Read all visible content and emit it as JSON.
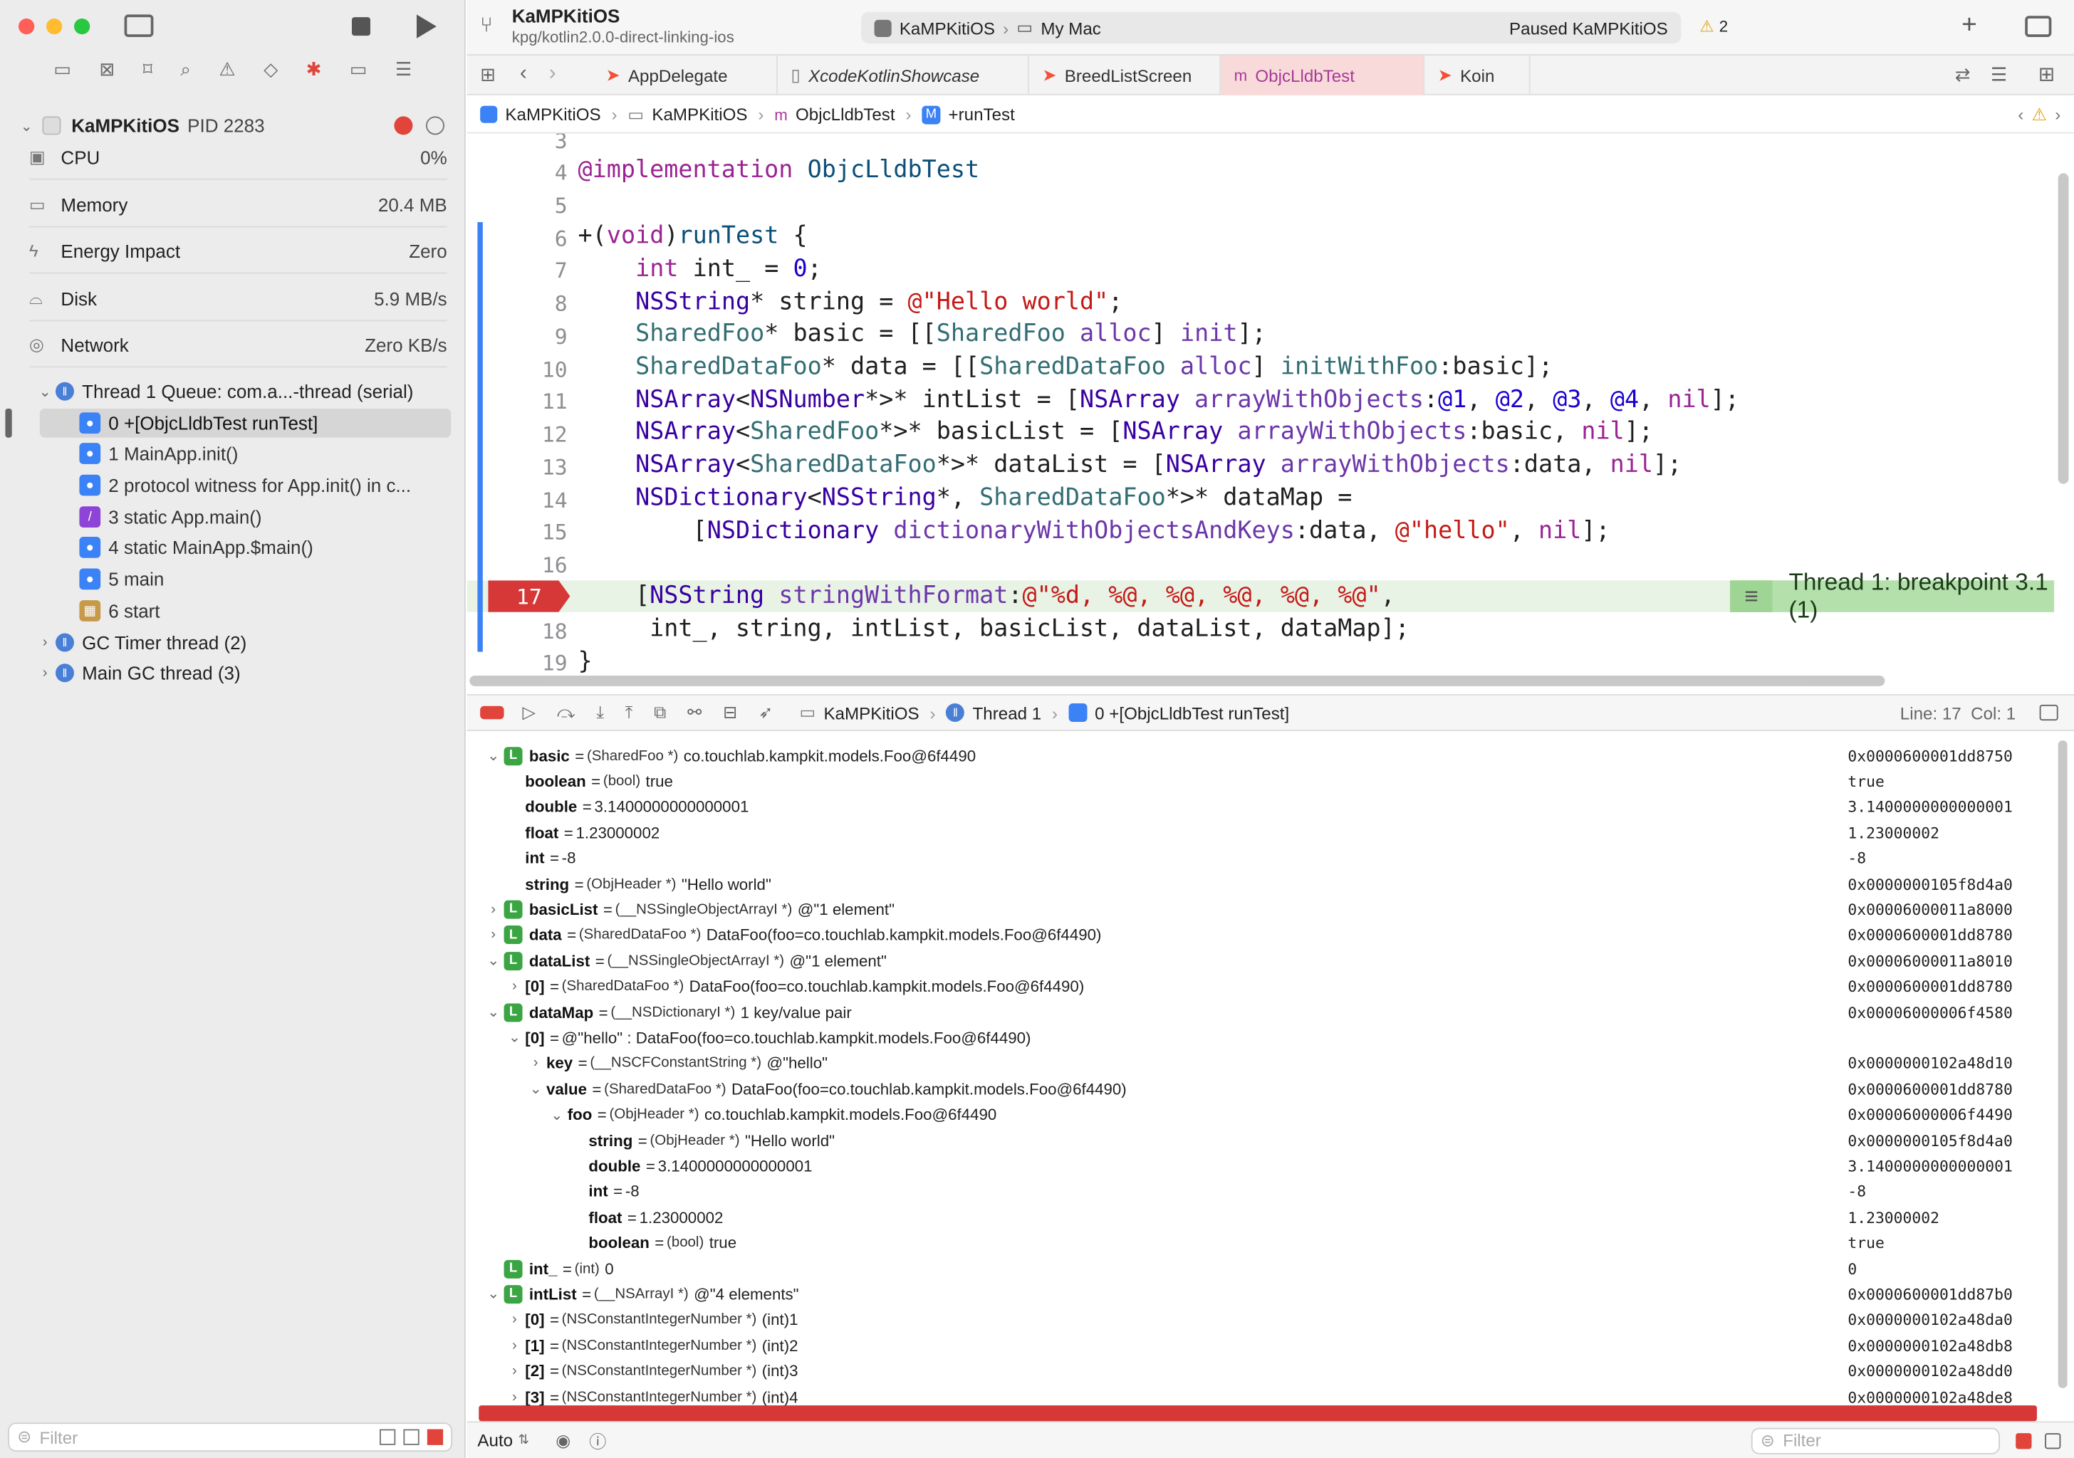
{
  "window": {
    "scheme": "KaMPKitiOS",
    "branch": "kpg/kotlin2.0.0-direct-linking-ios",
    "run_target": "KaMPKitiOS",
    "run_destination": "My Mac",
    "status": "Paused KaMPKitiOS",
    "warnings": "2"
  },
  "tabs": [
    {
      "label": "AppDelegate",
      "icon": "swift-icon"
    },
    {
      "label": "XcodeKotlinShowcase",
      "icon": "file-icon"
    },
    {
      "label": "BreedListScreen",
      "icon": "swift-icon"
    },
    {
      "label": "ObjcLldbTest",
      "icon": "m",
      "active": true
    },
    {
      "label": "Koin",
      "icon": "swift-icon"
    }
  ],
  "breadcrumb": [
    "KaMPKitiOS",
    "KaMPKitiOS",
    "ObjcLldbTest",
    "+runTest"
  ],
  "process": {
    "name": "KaMPKitiOS",
    "pid": "PID 2283"
  },
  "gauges": [
    {
      "label": "CPU",
      "value": "0%"
    },
    {
      "label": "Memory",
      "value": "20.4 MB"
    },
    {
      "label": "Energy Impact",
      "value": "Zero"
    },
    {
      "label": "Disk",
      "value": "5.9 MB/s"
    },
    {
      "label": "Network",
      "value": "Zero KB/s"
    }
  ],
  "thread1": "Thread 1 Queue: com.a...-thread (serial)",
  "frames": [
    "0 +[ObjcLldbTest runTest]",
    "1 MainApp.init()",
    "2 protocol witness for App.init() in c...",
    "3 static App.main()",
    "4 static MainApp.$main()",
    "5 main",
    "6 start"
  ],
  "other_threads": [
    "GC Timer thread (2)",
    "Main GC thread (3)"
  ],
  "filter_placeholder": "Filter",
  "line_numbers": [
    "3",
    "4",
    "5",
    "6",
    "7",
    "8",
    "9",
    "10",
    "11",
    "12",
    "13",
    "14",
    "15",
    "16",
    "17",
    "18",
    "19"
  ],
  "breakpoint_label": "Thread 1: breakpoint 3.1 (1)",
  "debug_bar": {
    "target": "KaMPKitiOS",
    "thread": "Thread 1",
    "frame": "0 +[ObjcLldbTest runTest]",
    "position": "Line: 17  Col: 1"
  },
  "variables": [
    {
      "d": 0,
      "exp": "v",
      "L": true,
      "name": "basic",
      "type": "(SharedFoo *)",
      "val": "co.touchlab.kampkit.models.Foo@6f4490",
      "addr": "0x0000600001dd8750"
    },
    {
      "d": 1,
      "name": "boolean",
      "type": "(bool)",
      "val": "true",
      "addr": "true"
    },
    {
      "d": 1,
      "name": "double",
      "type": "",
      "val": "3.1400000000000001",
      "addr": "3.1400000000000001"
    },
    {
      "d": 1,
      "name": "float",
      "type": "",
      "val": "1.23000002",
      "addr": "1.23000002"
    },
    {
      "d": 1,
      "name": "int",
      "type": "",
      "val": "-8",
      "addr": "-8"
    },
    {
      "d": 1,
      "name": "string",
      "type": "(ObjHeader *)",
      "val": "\"Hello world\"",
      "addr": "0x0000000105f8d4a0"
    },
    {
      "d": 0,
      "exp": ">",
      "L": true,
      "name": "basicList",
      "type": "(__NSSingleObjectArrayI *)",
      "val": "@\"1 element\"",
      "addr": "0x00006000011a8000"
    },
    {
      "d": 0,
      "exp": ">",
      "L": true,
      "name": "data",
      "type": "(SharedDataFoo *)",
      "val": "DataFoo(foo=co.touchlab.kampkit.models.Foo@6f4490)",
      "addr": "0x0000600001dd8780"
    },
    {
      "d": 0,
      "exp": "v",
      "L": true,
      "name": "dataList",
      "type": "(__NSSingleObjectArrayI *)",
      "val": "@\"1 element\"",
      "addr": "0x00006000011a8010"
    },
    {
      "d": 1,
      "exp": ">",
      "name": "[0]",
      "type": "(SharedDataFoo *)",
      "val": "DataFoo(foo=co.touchlab.kampkit.models.Foo@6f4490)",
      "addr": "0x0000600001dd8780"
    },
    {
      "d": 0,
      "exp": "v",
      "L": true,
      "name": "dataMap",
      "type": "(__NSDictionaryI *)",
      "val": "1 key/value pair",
      "addr": "0x00006000006f4580"
    },
    {
      "d": 1,
      "exp": "v",
      "name": "[0]",
      "type": "",
      "val": "@\"hello\" : DataFoo(foo=co.touchlab.kampkit.models.Foo@6f4490)",
      "addr": ""
    },
    {
      "d": 2,
      "exp": ">",
      "name": "key",
      "type": "(__NSCFConstantString *)",
      "val": "@\"hello\"",
      "addr": "0x0000000102a48d10"
    },
    {
      "d": 2,
      "exp": "v",
      "name": "value",
      "type": "(SharedDataFoo *)",
      "val": "DataFoo(foo=co.touchlab.kampkit.models.Foo@6f4490)",
      "addr": "0x0000600001dd8780"
    },
    {
      "d": 3,
      "exp": "v",
      "name": "foo",
      "type": "(ObjHeader *)",
      "val": "co.touchlab.kampkit.models.Foo@6f4490",
      "addr": "0x00006000006f4490"
    },
    {
      "d": 4,
      "name": "string",
      "type": "(ObjHeader *)",
      "val": "\"Hello world\"",
      "addr": "0x0000000105f8d4a0"
    },
    {
      "d": 4,
      "name": "double",
      "type": "",
      "val": "3.1400000000000001",
      "addr": "3.1400000000000001"
    },
    {
      "d": 4,
      "name": "int",
      "type": "",
      "val": "-8",
      "addr": "-8"
    },
    {
      "d": 4,
      "name": "float",
      "type": "",
      "val": "1.23000002",
      "addr": "1.23000002"
    },
    {
      "d": 4,
      "name": "boolean",
      "type": "(bool)",
      "val": "true",
      "addr": "true"
    },
    {
      "d": 0,
      "L": true,
      "name": "int_",
      "type": "(int)",
      "val": "0",
      "addr": "0"
    },
    {
      "d": 0,
      "exp": "v",
      "L": true,
      "name": "intList",
      "type": "(__NSArrayI *)",
      "val": "@\"4 elements\"",
      "addr": "0x0000600001dd87b0"
    },
    {
      "d": 1,
      "exp": ">",
      "name": "[0]",
      "type": "(NSConstantIntegerNumber *)",
      "val": "(int)1",
      "addr": "0x0000000102a48da0"
    },
    {
      "d": 1,
      "exp": ">",
      "name": "[1]",
      "type": "(NSConstantIntegerNumber *)",
      "val": "(int)2",
      "addr": "0x0000000102a48db8"
    },
    {
      "d": 1,
      "exp": ">",
      "name": "[2]",
      "type": "(NSConstantIntegerNumber *)",
      "val": "(int)3",
      "addr": "0x0000000102a48dd0"
    },
    {
      "d": 1,
      "exp": ">",
      "name": "[3]",
      "type": "(NSConstantIntegerNumber *)",
      "val": "(int)4",
      "addr": "0x0000000102a48de8"
    }
  ],
  "bottom": {
    "mode": "Auto",
    "filter_placeholder": "Filter"
  },
  "colors": {
    "breakpoint": "#d63737",
    "current_line": "#e8f3e6",
    "accent": "#3b82f6"
  }
}
